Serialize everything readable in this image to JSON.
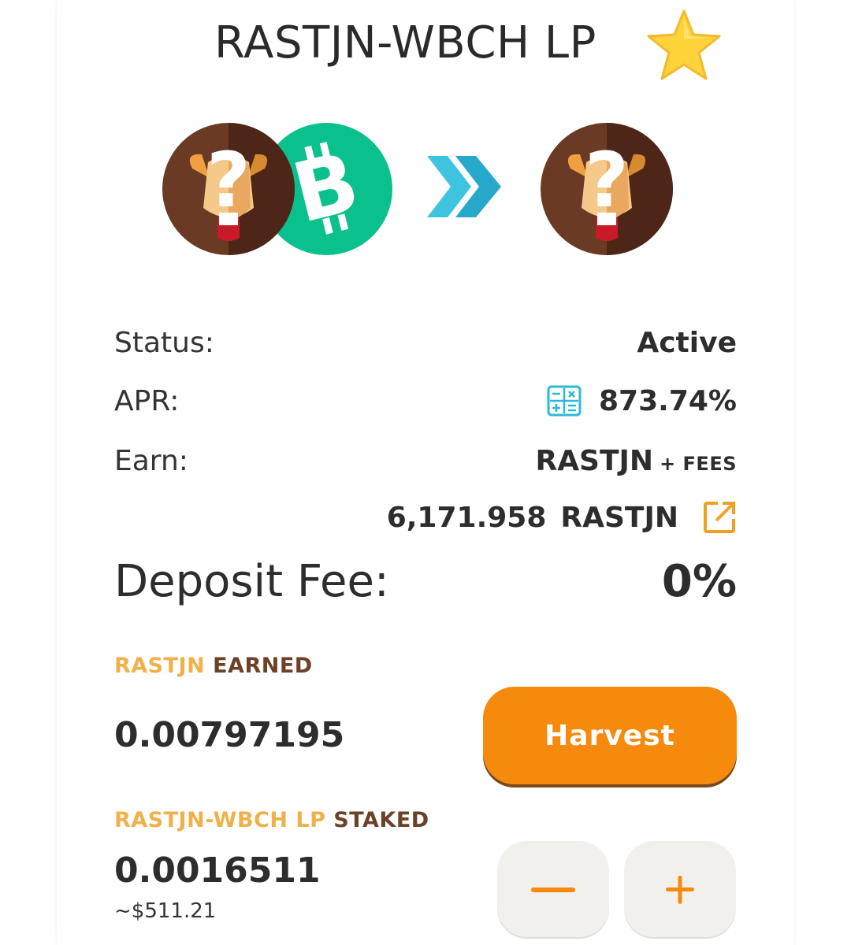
{
  "header": {
    "title": "RASTJN-WBCH LP"
  },
  "icons": {
    "favorite": "star-icon",
    "calculator": "calculator-icon",
    "external_link": "external-link-icon",
    "token_a": "rastjn-token-icon",
    "token_b": "bch-token-icon",
    "arrow": "double-chevron-right-icon"
  },
  "colors": {
    "accent": "#f58a0c",
    "gold": "#f0b04a",
    "brown": "#6b4128",
    "bch_green": "#0ac18e",
    "teal": "#2db9d6"
  },
  "stats": {
    "status_label": "Status:",
    "status_value": "Active",
    "apr_label": "APR:",
    "apr_value": "873.74%",
    "earn_label": "Earn:",
    "earn_token": "RASTJN",
    "earn_fees": "+ FEES",
    "reward_amount": "6,171.958",
    "reward_token": "RASTJN",
    "deposit_fee_label": "Deposit Fee:",
    "deposit_fee_value": "0%"
  },
  "earned": {
    "title_token": "RASTJN",
    "title_suffix": "EARNED",
    "amount": "0.00797195",
    "harvest_label": "Harvest"
  },
  "staked": {
    "title_token": "RASTJN-WBCH LP",
    "title_suffix": "STAKED",
    "amount": "0.0016511",
    "usd": "~$511.21",
    "minus_label": "−",
    "plus_label": "+"
  }
}
